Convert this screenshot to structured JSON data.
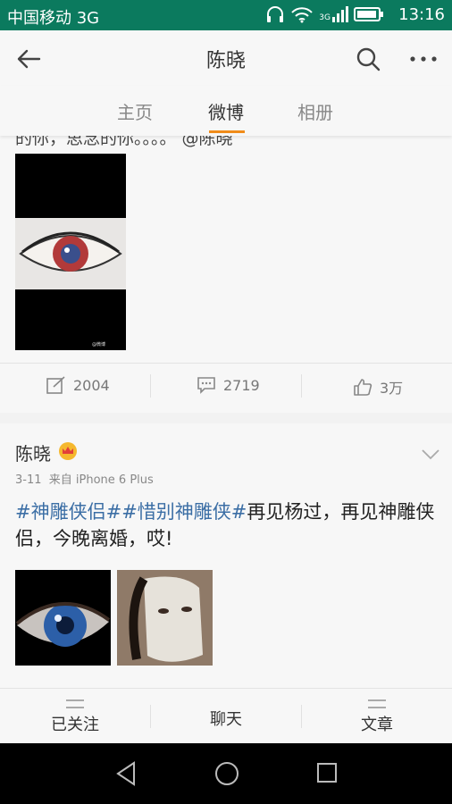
{
  "status_bar": {
    "carrier": "中国移动 3G",
    "time": "13:16",
    "network_tag": "3G"
  },
  "header": {
    "title": "陈晓"
  },
  "tabs": [
    {
      "label": "主页"
    },
    {
      "label": "微博"
    },
    {
      "label": "相册"
    }
  ],
  "post1": {
    "text_cut": "的你，思念的你。。。。 @陈晓",
    "image_watermark": "@微博",
    "actions": {
      "repost": "2004",
      "comment": "2719",
      "like": "3万"
    }
  },
  "post2": {
    "author": "陈晓",
    "date": "3-11",
    "source": "来自 iPhone 6 Plus",
    "tag1": "#神雕侠侣#",
    "tag2": "#惜别神雕侠#",
    "body": "再见杨过，再见神雕侠侣，今晚离婚，哎!"
  },
  "bottom_bar": {
    "follow": "已关注",
    "chat": "聊天",
    "article": "文章"
  },
  "colors": {
    "status_bg": "#0b7a5e",
    "accent": "#f08c1a",
    "link": "#3b6ea5"
  },
  "icons": [
    "back-arrow-icon",
    "search-icon",
    "more-icon",
    "repost-icon",
    "comment-icon",
    "like-icon",
    "chevron-down-icon",
    "crown-badge-icon",
    "nav-back-icon",
    "nav-home-icon",
    "nav-recents-icon"
  ]
}
